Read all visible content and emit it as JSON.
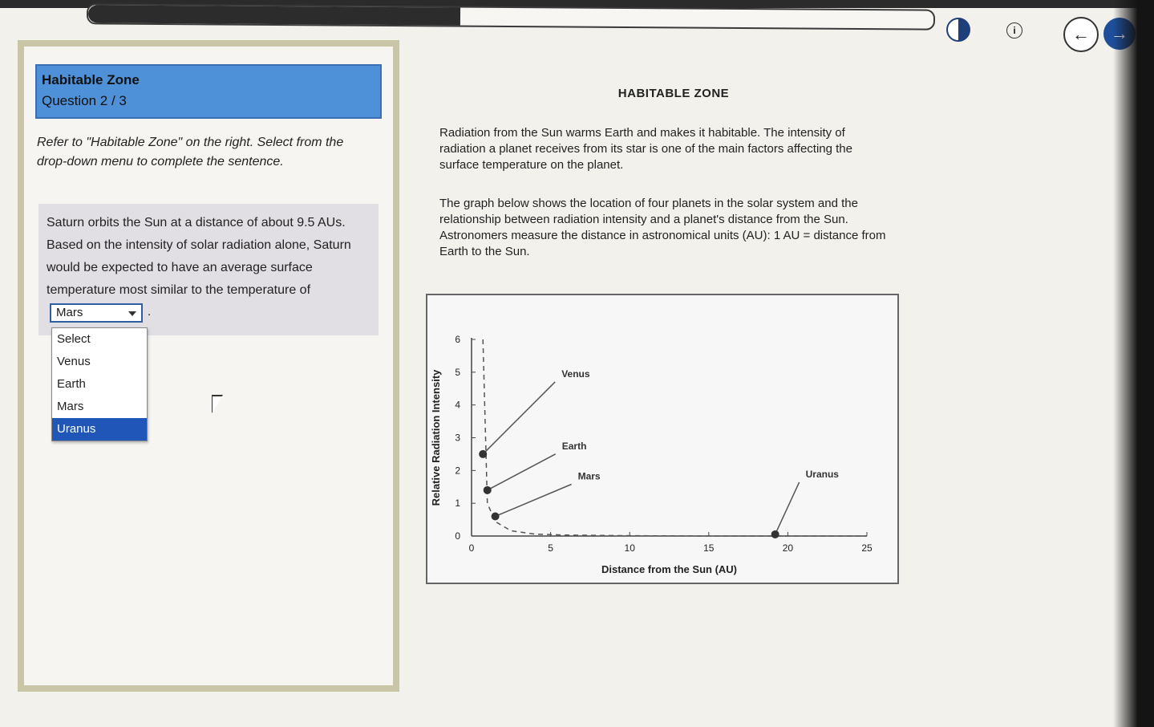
{
  "toolbar": {
    "progress_fraction": 0.44,
    "contrast_icon": "contrast-icon",
    "info_icon": "info-icon",
    "info_symbol": "i",
    "back_icon": "arrow-left-icon",
    "back_symbol": "←",
    "next_icon": "arrow-right-icon",
    "next_symbol": "→"
  },
  "question": {
    "title": "Habitable Zone",
    "count": "Question 2 / 3",
    "instructions": "Refer to \"Habitable Zone\" on the right. Select from the drop-down menu to complete the sentence.",
    "text": "Saturn orbits the Sun at a distance of about 9.5 AUs. Based on the intensity of solar radiation alone, Saturn would be expected to have an average surface temperature most similar to the temperature of",
    "dropdown": {
      "selected": "Mars",
      "options": [
        "Select",
        "Venus",
        "Earth",
        "Mars",
        "Uranus"
      ],
      "highlighted": "Uranus"
    },
    "period": "."
  },
  "reading": {
    "title": "HABITABLE ZONE",
    "paragraph1": "Radiation from the Sun warms Earth and makes it habitable. The intensity of radiation a planet receives from its star is one of the main factors affecting the surface temperature on the planet.",
    "paragraph2": "The graph below shows the location of four planets in the solar system and the relationship between radiation intensity and a planet's distance from the Sun. Astronomers measure the distance in astronomical units (AU): 1 AU = distance from Earth to the Sun."
  },
  "chart_data": {
    "type": "scatter",
    "xlabel": "Distance from the Sun (AU)",
    "ylabel": "Relative Radiation Intensity",
    "xlim": [
      0,
      25
    ],
    "ylim": [
      0,
      6
    ],
    "xticks": [
      0,
      5,
      10,
      15,
      20,
      25
    ],
    "yticks": [
      0,
      1,
      2,
      3,
      4,
      5,
      6
    ],
    "points": [
      {
        "label": "Venus",
        "x": 0.72,
        "y": 2.5
      },
      {
        "label": "Earth",
        "x": 1.0,
        "y": 1.4
      },
      {
        "label": "Mars",
        "x": 1.5,
        "y": 0.6
      },
      {
        "label": "Uranus",
        "x": 19.2,
        "y": 0.05
      }
    ],
    "curve": {
      "style": "dashed",
      "x": [
        0.72,
        1.0,
        1.5,
        2.5,
        4,
        6,
        10,
        15,
        20,
        25
      ],
      "y": [
        6,
        1.0,
        0.44,
        0.16,
        0.06,
        0.03,
        0.01,
        0.0,
        0.0,
        0.0
      ]
    }
  }
}
